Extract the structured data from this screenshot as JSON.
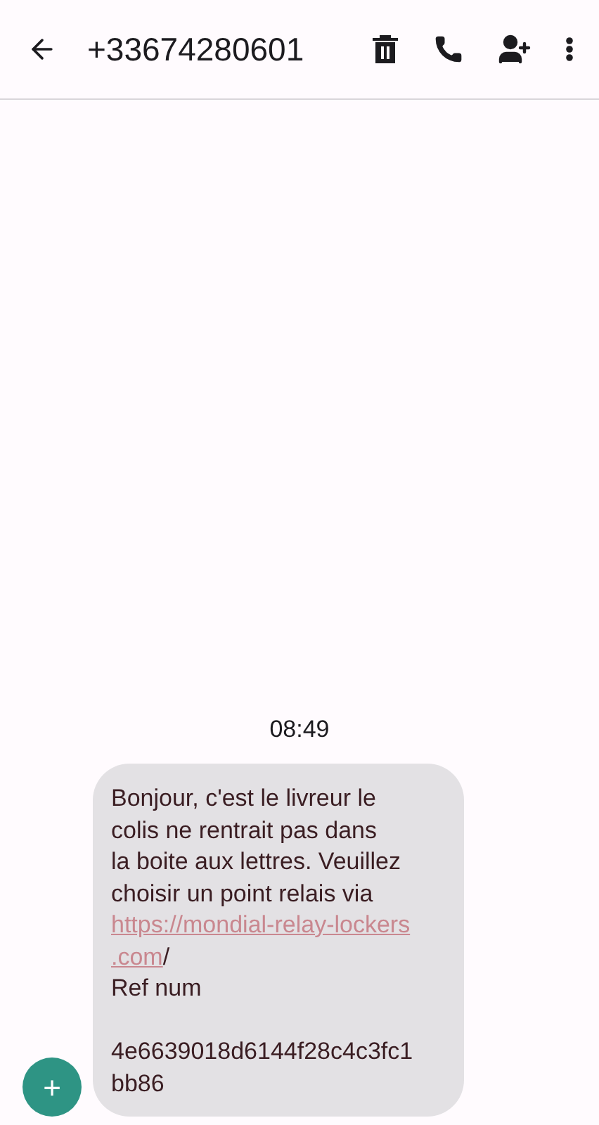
{
  "header": {
    "title": "+33674280601"
  },
  "time": "08:49",
  "message": {
    "lines": [
      [
        {
          "kind": "text",
          "text": "Bonjour, c'est le livreur le"
        }
      ],
      [
        {
          "kind": "text",
          "text": "colis ne rentrait pas dans"
        }
      ],
      [
        {
          "kind": "text",
          "text": "la boite aux lettres. Veuillez"
        }
      ],
      [
        {
          "kind": "text",
          "text": "choisir un point relais via"
        }
      ],
      [
        {
          "kind": "link",
          "text": "https://mondial-relay-lockers"
        }
      ],
      [
        {
          "kind": "link",
          "text": ".com"
        },
        {
          "kind": "text",
          "text": "/"
        }
      ],
      [
        {
          "kind": "text",
          "text": "Ref num"
        }
      ],
      [
        {
          "kind": "blank"
        }
      ],
      [
        {
          "kind": "text",
          "text": "4e6639018d6144f28c4c3fc1"
        }
      ],
      [
        {
          "kind": "text",
          "text": "bb86"
        }
      ]
    ]
  },
  "fab": {
    "label": "+"
  }
}
